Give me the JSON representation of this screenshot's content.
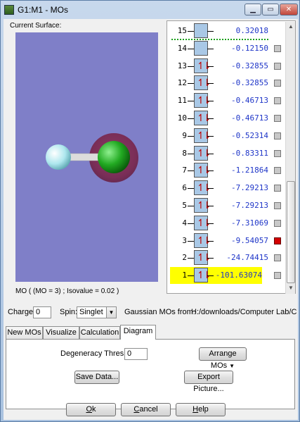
{
  "window": {
    "title": "G1:M1 - MOs",
    "controls": {
      "minimize": "▁",
      "maximize": "▭",
      "close": "✕"
    }
  },
  "left_panel": {
    "surface_label": "Current Surface:",
    "mo_caption": "MO ( (MO = 3) ; Isovalue = 0.02 )"
  },
  "molecule": {
    "atoms": [
      {
        "name": "hydrogen",
        "color": "#aee7ee"
      },
      {
        "name": "chlorine",
        "color": "#22aa22"
      }
    ],
    "surface_color": "#7a2e57",
    "background": "#7f7fc8"
  },
  "mo_list": {
    "homo_index": 13,
    "items": [
      {
        "num": "15",
        "value": "0.32018",
        "occupied": false,
        "checked": null,
        "selected": false
      },
      {
        "num": "14",
        "value": "-0.12150",
        "occupied": false,
        "checked": false,
        "selected": false
      },
      {
        "num": "13",
        "value": "-0.32855",
        "occupied": true,
        "checked": false,
        "selected": false
      },
      {
        "num": "12",
        "value": "-0.32855",
        "occupied": true,
        "checked": false,
        "selected": false
      },
      {
        "num": "11",
        "value": "-0.46713",
        "occupied": true,
        "checked": false,
        "selected": false
      },
      {
        "num": "10",
        "value": "-0.46713",
        "occupied": true,
        "checked": false,
        "selected": false
      },
      {
        "num": "9",
        "value": "-0.52314",
        "occupied": true,
        "checked": false,
        "selected": false
      },
      {
        "num": "8",
        "value": "-0.83311",
        "occupied": true,
        "checked": false,
        "selected": false
      },
      {
        "num": "7",
        "value": "-1.21864",
        "occupied": true,
        "checked": false,
        "selected": false
      },
      {
        "num": "6",
        "value": "-7.29213",
        "occupied": true,
        "checked": false,
        "selected": false
      },
      {
        "num": "5",
        "value": "-7.29213",
        "occupied": true,
        "checked": false,
        "selected": false
      },
      {
        "num": "4",
        "value": "-7.31069",
        "occupied": true,
        "checked": false,
        "selected": false
      },
      {
        "num": "3",
        "value": "-9.54057",
        "occupied": true,
        "checked": true,
        "selected": false
      },
      {
        "num": "2",
        "value": "-24.74415",
        "occupied": true,
        "checked": false,
        "selected": false
      },
      {
        "num": "1",
        "value": "-101.63074",
        "occupied": true,
        "checked": false,
        "selected": true
      }
    ],
    "occupied_glyph": "↿⇂",
    "colors": {
      "value": "#1f36c8",
      "arrow": "#c00000",
      "highlight": "#ffff00",
      "checked": "#d40000",
      "homo_line": "#1aa01a"
    }
  },
  "controls_bar": {
    "charge_label": "Charge:",
    "charge_value": "0",
    "spin_label": "Spin:",
    "spin_value": "Singlet",
    "source_label": "Gaussian MOs from:",
    "source_path": "H:/downloads/Computer Lab/Cl_F_F"
  },
  "tabs": [
    {
      "label": "New MOs",
      "active": false
    },
    {
      "label": "Visualize",
      "active": false
    },
    {
      "label": "Calculation",
      "active": false
    },
    {
      "label": "Diagram",
      "active": true
    }
  ],
  "diagram_tab": {
    "degeneracy_label": "Degeneracy Threshold:",
    "degeneracy_value": "0",
    "arrange_label": "Arrange MOs",
    "save_label": "Save Data...",
    "export_label": "Export Picture..."
  },
  "footer": {
    "ok": {
      "underline": "O",
      "rest": "k"
    },
    "cancel": {
      "underline": "C",
      "rest": "ancel"
    },
    "help": {
      "underline": "H",
      "rest": "elp"
    }
  }
}
